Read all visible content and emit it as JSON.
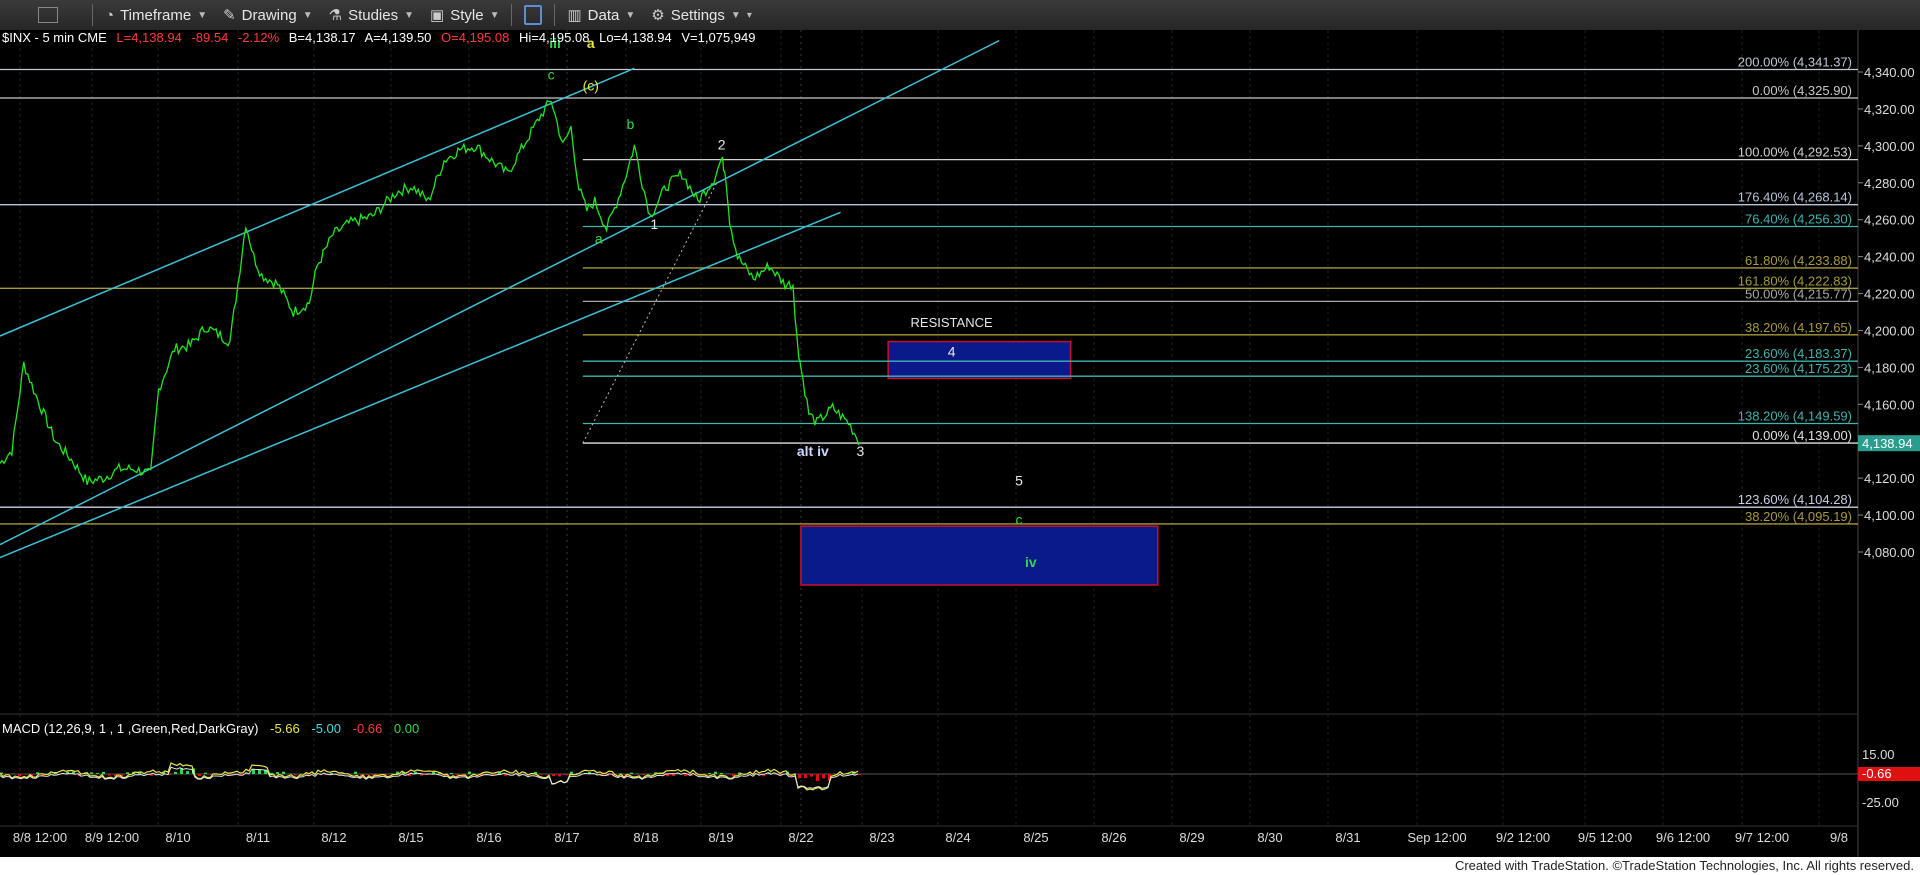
{
  "toolbar": {
    "timeframe": "Timeframe",
    "drawing": "Drawing",
    "studies": "Studies",
    "style": "Style",
    "data": "Data",
    "settings": "Settings"
  },
  "header": {
    "symbol": "$INX - 5 min  CME",
    "last": "L=4,138.94",
    "change": "-89.54",
    "pct": "-2.12%",
    "bid": "B=4,138.17",
    "ask": "A=4,139.50",
    "open": "O=4,195.08",
    "hi": "Hi=4,195.08",
    "lo": "Lo=4,138.94",
    "vol": "V=1,075,949"
  },
  "macd": {
    "label": "MACD (12,26,9, 1 , 1 ,Green,Red,DarkGray)",
    "v1": "-5.66",
    "v2": "-5.00",
    "v3": "-0.66",
    "v4": "0.00",
    "axis_top": "15.00",
    "axis_current": "-0.66",
    "axis_bottom": "-25.00"
  },
  "footer": "Created with TradeStation. ©TradeStation Technologies, Inc. All rights reserved.",
  "colors": {
    "price_line": "#1ee81e",
    "channel": "#3ec1d6",
    "box_fill": "#0a1a8a",
    "box_border": "#c8102e",
    "white_line": "#c8c8c8",
    "wave_green": "#2fd84a",
    "wave_yellow": "#e8e83a",
    "last_price_bg": "#2a9d8f"
  },
  "chart_data": {
    "type": "line",
    "ylim": [
      4060,
      4360
    ],
    "y_ticks": [
      "4,340.00",
      "4,320.00",
      "4,300.00",
      "4,280.00",
      "4,260.00",
      "4,240.00",
      "4,220.00",
      "4,200.00",
      "4,180.00",
      "4,160.00",
      "4,140.00",
      "4,120.00",
      "4,100.00",
      "4,080.00"
    ],
    "y_tick_values": [
      4340,
      4320,
      4300,
      4280,
      4260,
      4240,
      4220,
      4200,
      4180,
      4160,
      4140,
      4120,
      4100,
      4080
    ],
    "x_ticks": [
      "8/8 12:00",
      "8/9 12:00",
      "8/10",
      "8/11",
      "8/12",
      "8/15",
      "8/16",
      "8/17",
      "8/18",
      "8/19",
      "8/22",
      "8/23",
      "8/24",
      "8/25",
      "8/26",
      "8/29",
      "8/30",
      "8/31",
      "Sep 12:00",
      "9/2 12:00",
      "9/5 12:00",
      "9/6 12:00",
      "9/7 12:00",
      "9/8"
    ],
    "last_price": "4,138.94",
    "last_price_value": 4138.94,
    "price_series": [
      [
        0,
        4128
      ],
      [
        0.15,
        4135
      ],
      [
        0.3,
        4182
      ],
      [
        0.45,
        4165
      ],
      [
        0.7,
        4140
      ],
      [
        0.9,
        4130
      ],
      [
        1.1,
        4118
      ],
      [
        1.3,
        4120
      ],
      [
        1.5,
        4125
      ],
      [
        1.7,
        4125
      ],
      [
        1.9,
        4122
      ],
      [
        2.0,
        4168
      ],
      [
        2.2,
        4190
      ],
      [
        2.4,
        4192
      ],
      [
        2.6,
        4202
      ],
      [
        2.9,
        4194
      ],
      [
        3.0,
        4225
      ],
      [
        3.1,
        4258
      ],
      [
        3.2,
        4240
      ],
      [
        3.3,
        4230
      ],
      [
        3.5,
        4225
      ],
      [
        3.7,
        4210
      ],
      [
        3.9,
        4215
      ],
      [
        4.0,
        4235
      ],
      [
        4.2,
        4252
      ],
      [
        4.4,
        4258
      ],
      [
        4.7,
        4262
      ],
      [
        5.0,
        4275
      ],
      [
        5.2,
        4278
      ],
      [
        5.4,
        4270
      ],
      [
        5.6,
        4292
      ],
      [
        5.8,
        4298
      ],
      [
        6.0,
        4300
      ],
      [
        6.2,
        4292
      ],
      [
        6.4,
        4285
      ],
      [
        6.6,
        4300
      ],
      [
        6.8,
        4315
      ],
      [
        6.95,
        4325
      ],
      [
        7.1,
        4300
      ],
      [
        7.2,
        4310
      ],
      [
        7.3,
        4277
      ],
      [
        7.4,
        4265
      ],
      [
        7.5,
        4270
      ],
      [
        7.65,
        4255
      ],
      [
        7.8,
        4272
      ],
      [
        7.9,
        4285
      ],
      [
        8.0,
        4300
      ],
      [
        8.1,
        4280
      ],
      [
        8.2,
        4262
      ],
      [
        8.4,
        4278
      ],
      [
        8.6,
        4285
      ],
      [
        8.8,
        4270
      ],
      [
        9.0,
        4282
      ],
      [
        9.1,
        4293
      ],
      [
        9.15,
        4285
      ],
      [
        9.2,
        4260
      ],
      [
        9.3,
        4240
      ],
      [
        9.5,
        4228
      ],
      [
        9.7,
        4235
      ],
      [
        9.9,
        4225
      ],
      [
        10.0,
        4225
      ],
      [
        10.05,
        4195
      ],
      [
        10.1,
        4180
      ],
      [
        10.2,
        4155
      ],
      [
        10.3,
        4150
      ],
      [
        10.5,
        4158
      ],
      [
        10.7,
        4150
      ],
      [
        10.85,
        4138.94
      ]
    ],
    "annotations": [
      {
        "text": "iii",
        "color": "green",
        "x": 7.0,
        "y": 4353
      },
      {
        "text": "a",
        "color": "yellow",
        "x": 7.45,
        "y": 4353
      },
      {
        "text": "c",
        "color": "green",
        "x": 6.95,
        "y": 4336
      },
      {
        "text": "(c)",
        "color": "yellow",
        "x": 7.45,
        "y": 4330
      },
      {
        "text": "b",
        "color": "green",
        "x": 7.95,
        "y": 4309
      },
      {
        "text": "2",
        "color": "white",
        "x": 9.1,
        "y": 4298
      },
      {
        "text": "a",
        "color": "green",
        "x": 7.55,
        "y": 4247
      },
      {
        "text": "1",
        "color": "white",
        "x": 8.25,
        "y": 4255
      },
      {
        "text": "RESISTANCE",
        "color": "white",
        "x": 12.0,
        "y": 4202
      },
      {
        "text": "4",
        "color": "white",
        "x": 12.0,
        "y": 4186
      },
      {
        "text": "alt iv",
        "color": "blue",
        "x": 10.25,
        "y": 4132
      },
      {
        "text": "3",
        "color": "white",
        "x": 10.85,
        "y": 4132
      },
      {
        "text": "5",
        "color": "white",
        "x": 12.85,
        "y": 4116
      },
      {
        "text": "c",
        "color": "green",
        "x": 12.85,
        "y": 4095
      },
      {
        "text": "iv",
        "color": "green",
        "x": 13.0,
        "y": 4072
      }
    ],
    "fib_levels": [
      {
        "label": "200.00% (4,341.37)",
        "value": 4341.37,
        "color": "#c0c8d0",
        "x_from": 0
      },
      {
        "label": "0.00% (4,325.90)",
        "value": 4325.9,
        "color": "#c8c8c8",
        "x_from": 0
      },
      {
        "label": "100.00% (4,292.53)",
        "value": 4292.53,
        "color": "#d0d0d0",
        "x_from": 7.35
      },
      {
        "label": "176.40% (4,268.14)",
        "value": 4268.14,
        "color": "#b8c4d8",
        "x_from": 0
      },
      {
        "label": "76.40% (4,256.30)",
        "value": 4256.3,
        "color": "#40b4b0",
        "x_from": 7.35
      },
      {
        "label": "61.80% (4,233.88)",
        "value": 4233.88,
        "color": "#a89a3a",
        "x_from": 7.35
      },
      {
        "label": "161.80% (4,222.83)",
        "value": 4222.83,
        "color": "#a89a3a",
        "x_from": 0
      },
      {
        "label": "50.00% (4,215.77)",
        "value": 4215.77,
        "color": "#a8a8a8",
        "x_from": 7.35
      },
      {
        "label": "38.20% (4,197.65)",
        "value": 4197.65,
        "color": "#a89a3a",
        "x_from": 7.35
      },
      {
        "label": "23.60% (4,183.37)",
        "value": 4183.37,
        "color": "#40b4b0",
        "x_from": 7.35
      },
      {
        "label": "23.60% (4,175.23)",
        "value": 4175.23,
        "color": "#40b4b0",
        "x_from": 7.35
      },
      {
        "label": "138.20% (4,149.59)",
        "value": 4149.59,
        "color": "#40b4b0",
        "x_from": 7.35
      },
      {
        "label": "0.00% (4,139.00)",
        "value": 4139.0,
        "color": "#e0e0e0",
        "x_from": 7.35
      },
      {
        "label": "123.60% (4,104.28)",
        "value": 4104.28,
        "color": "#c8d0e0",
        "x_from": 0
      },
      {
        "label": "38.20% (4,095.19)",
        "value": 4095.19,
        "color": "#a89a3a",
        "x_from": 0
      }
    ],
    "zones": [
      {
        "name": "resistance",
        "x_from": 11.2,
        "x_to": 13.5,
        "y_from": 4174,
        "y_to": 4194
      },
      {
        "name": "target",
        "x_from": 10.1,
        "x_to": 14.6,
        "y_from": 4060,
        "y_to": 4094
      }
    ],
    "channels": [
      {
        "x1": 0,
        "y1": 4197,
        "x2": 8.0,
        "y2": 4342
      },
      {
        "x1": 0,
        "y1": 4084,
        "x2": 12.6,
        "y2": 4357
      },
      {
        "x1": 0,
        "y1": 4077,
        "x2": 10.6,
        "y2": 4264
      }
    ],
    "dotted": {
      "x1": 7.35,
      "y1": 4139,
      "x2": 9.05,
      "y2": 4281
    }
  }
}
